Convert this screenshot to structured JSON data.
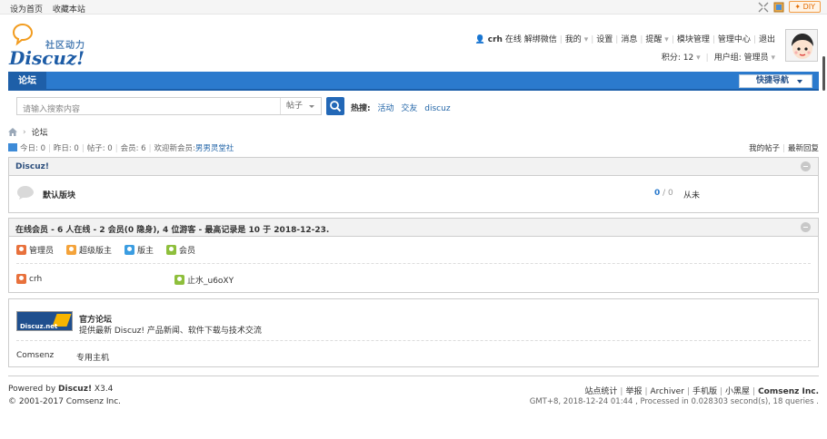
{
  "topbar": {
    "set_home": "设为首页",
    "bookmark": "收藏本站",
    "diy_label": "DIY"
  },
  "logo": {
    "slogan": "社区动力",
    "word": "Discuz!"
  },
  "user_menu": {
    "username": "crh",
    "online": "在线",
    "wechat": "解绑微信",
    "mine": "我的",
    "settings": "设置",
    "messages": "消息",
    "reminders": "提醒",
    "module_mgmt": "模块管理",
    "admin_center": "管理中心",
    "logout": "退出",
    "credits": "积分: 12",
    "user_group": "用户组: 管理员"
  },
  "nav": {
    "current": "论坛",
    "quick_nav": "快捷导航"
  },
  "search": {
    "placeholder": "请输入搜索内容",
    "type": "帖子",
    "hot_label": "热搜:",
    "hot": [
      "活动",
      "交友",
      "discuz"
    ]
  },
  "breadcrumb": {
    "current": "论坛"
  },
  "stats": {
    "today": "今日: 0",
    "yesterday": "昨日: 0",
    "posts": "帖子: 0",
    "members": "会员: 6",
    "welcome_label": "欢迎新会员:",
    "newest_member": "男男灵堂社"
  },
  "right_links": {
    "my_posts": "我的帖子",
    "latest_replies": "最新回复"
  },
  "category": {
    "title": "Discuz!",
    "forum": {
      "name": "默认版块",
      "threads": "0",
      "slash": " / ",
      "posts": "0",
      "last_post": "从未"
    }
  },
  "online": {
    "title": "在线会员 - 6 人在线 - 2 会员(0 隐身), 4 位游客 - 最高记录是 10 于 2018-12-23.",
    "legend": [
      {
        "label": "管理员",
        "color": "#e8713c"
      },
      {
        "label": "超级版主",
        "color": "#f4a33a"
      },
      {
        "label": "版主",
        "color": "#3b9de1"
      },
      {
        "label": "会员",
        "color": "#8ebf3c"
      }
    ],
    "users": [
      {
        "name": "crh",
        "color": "#e8713c"
      },
      {
        "name": "止水_u6oXY",
        "color": "#8ebf3c"
      }
    ]
  },
  "friend_links": {
    "image_text": "Discuz.net",
    "name": "官方论坛",
    "desc": "提供最新 Discuz! 产品新闻、软件下载与技术交流",
    "text_links": [
      "Comsenz",
      "专用主机"
    ]
  },
  "footer": {
    "powered_prefix": "Powered by",
    "powered_name": "Discuz!",
    "version": "X3.4",
    "copyright": "© 2001-2017 Comsenz Inc.",
    "links": [
      "站点统计",
      "举报",
      "Archiver",
      "手机版",
      "小黑屋"
    ],
    "company": "Comsenz Inc.",
    "gmt": "GMT+8, 2018-12-24 01:44 , Processed in 0.028303 second(s), 18 queries ."
  },
  "colors": {
    "nav_blue": "#2b7acd",
    "link_blue": "#2366a8",
    "title_blue": "#2d4f7d"
  }
}
